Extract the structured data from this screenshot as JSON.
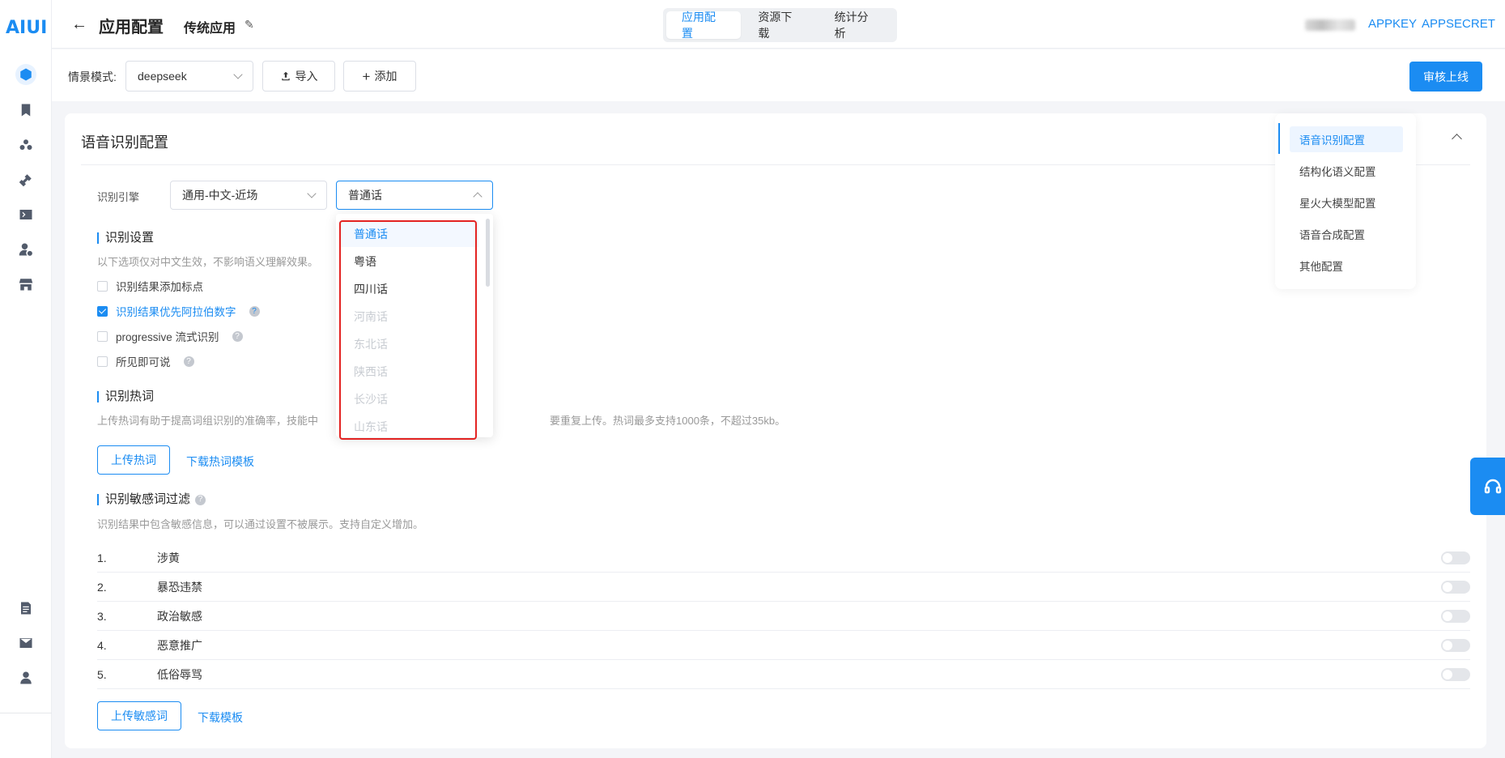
{
  "logo": "AIUI",
  "header": {
    "page_title": "应用配置",
    "app_name": "传统应用",
    "tabs": [
      "应用配置",
      "资源下载",
      "统计分析"
    ],
    "appkey": "APPKEY",
    "appsecret": "APPSECRET"
  },
  "toolbar": {
    "scene_label": "情景模式:",
    "scene_value": "deepseek",
    "import_label": "导入",
    "add_label": "添加",
    "publish_label": "审核上线"
  },
  "card": {
    "title": "语音识别配置",
    "engine_label": "识别引擎",
    "engine_value": "通用-中文-近场",
    "dialect_value": "普通话"
  },
  "recognition_settings": {
    "title": "识别设置",
    "desc": "以下选项仅对中文生效，不影响语义理解效果。",
    "options": [
      {
        "label": "识别结果添加标点",
        "checked": false,
        "help": false
      },
      {
        "label": "识别结果优先阿拉伯数字",
        "checked": true,
        "help": true
      },
      {
        "label": "progressive 流式识别",
        "checked": false,
        "help": true
      },
      {
        "label": "所见即可说",
        "checked": false,
        "help": true
      }
    ]
  },
  "hotwords": {
    "title": "识别热词",
    "desc_left": "上传热词有助于提高词组识别的准确率，技能中",
    "desc_right": "要重复上传。热词最多支持1000条，不超过35kb。",
    "upload_label": "上传热词",
    "download_label": "下载热词模板"
  },
  "sensitive": {
    "title": "识别敏感词过滤",
    "desc": "识别结果中包含敏感信息，可以通过设置不被展示。支持自定义增加。",
    "rows": [
      {
        "num": "1.",
        "label": "涉黄"
      },
      {
        "num": "2.",
        "label": "暴恐违禁"
      },
      {
        "num": "3.",
        "label": "政治敏感"
      },
      {
        "num": "4.",
        "label": "恶意推广"
      },
      {
        "num": "5.",
        "label": "低俗辱骂"
      }
    ],
    "upload_label": "上传敏感词",
    "download_label": "下载模板"
  },
  "anchor_nav": [
    "语音识别配置",
    "结构化语义配置",
    "星火大模型配置",
    "语音合成配置",
    "其他配置"
  ],
  "dialect_dropdown": [
    {
      "label": "普通话",
      "state": "selected"
    },
    {
      "label": "粤语",
      "state": "normal"
    },
    {
      "label": "四川话",
      "state": "normal"
    },
    {
      "label": "河南话",
      "state": "disabled"
    },
    {
      "label": "东北话",
      "state": "disabled"
    },
    {
      "label": "陕西话",
      "state": "disabled"
    },
    {
      "label": "长沙话",
      "state": "disabled"
    },
    {
      "label": "山东话",
      "state": "disabled"
    }
  ],
  "colors": {
    "accent": "#1b8cf2",
    "highlight": "#e32322"
  }
}
